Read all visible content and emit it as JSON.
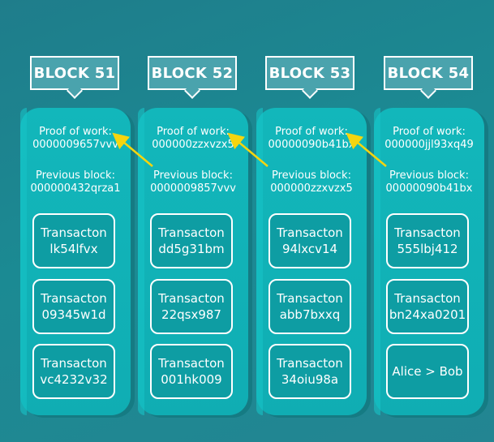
{
  "colors": {
    "background": "#1f8590",
    "column": "#10b1b6",
    "header_fill": "#4aa3ad",
    "transaction_fill": "#0e9da3",
    "arrow": "#f5d50f",
    "text": "#ffffff"
  },
  "labels": {
    "proof_of_work": "Proof of work:",
    "previous_block": "Previous block:"
  },
  "blocks": [
    {
      "title": "BLOCK 51",
      "proof_of_work": "0000009657vvv",
      "previous_block": "000000432qrza1",
      "transactions": [
        {
          "line1": "Transacton",
          "line2": "lk54lfvx"
        },
        {
          "line1": "Transacton",
          "line2": "09345w1d"
        },
        {
          "line1": "Transacton",
          "line2": "vc4232v32"
        }
      ]
    },
    {
      "title": "BLOCK 52",
      "proof_of_work": "000000zzxvzx5",
      "previous_block": "0000009857vvv",
      "transactions": [
        {
          "line1": "Transacton",
          "line2": "dd5g31bm"
        },
        {
          "line1": "Transacton",
          "line2": "22qsx987"
        },
        {
          "line1": "Transacton",
          "line2": "001hk009"
        }
      ]
    },
    {
      "title": "BLOCK 53",
      "proof_of_work": "00000090b41bx",
      "previous_block": "000000zzxvzx5",
      "transactions": [
        {
          "line1": "Transacton",
          "line2": "94lxcv14"
        },
        {
          "line1": "Transacton",
          "line2": "abb7bxxq"
        },
        {
          "line1": "Transacton",
          "line2": "34oiu98a"
        }
      ]
    },
    {
      "title": "BLOCK 54",
      "proof_of_work": "000000jjl93xq49",
      "previous_block": "00000090b41bx",
      "transactions": [
        {
          "line1": "Transacton",
          "line2": "555lbj412"
        },
        {
          "line1": "Transacton",
          "line2": "bn24xa0201"
        },
        {
          "line1": "Alice > Bob",
          "line2": ""
        }
      ]
    }
  ],
  "links": [
    {
      "from_block": 1,
      "to_block": 0
    },
    {
      "from_block": 2,
      "to_block": 1
    },
    {
      "from_block": 3,
      "to_block": 2
    }
  ]
}
